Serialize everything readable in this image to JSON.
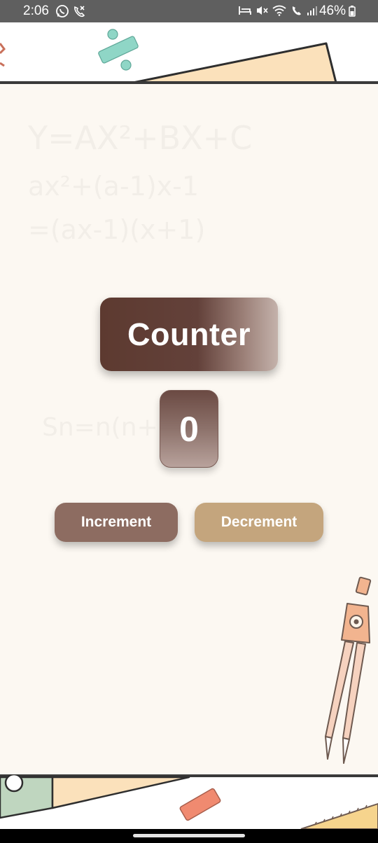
{
  "status_bar": {
    "time": "2:06",
    "battery": "46%",
    "left_icons": [
      "whatsapp-icon",
      "missed-call-icon"
    ],
    "right_icons": [
      "bed-icon",
      "mute-icon",
      "wifi-icon",
      "wifi-call-icon",
      "signal-icon",
      "battery-icon"
    ]
  },
  "counter": {
    "title": "Counter",
    "value": "0"
  },
  "buttons": {
    "increment_label": "Increment",
    "decrement_label": "Decrement"
  },
  "background_math": {
    "line1": "Y=AX²+BX+C",
    "line2": "ax²+(a-1)x-1",
    "line3": "=(ax-1)(x+1)",
    "line4": "Sn=n(n+2)"
  },
  "colors": {
    "title_gradient_start": "#5d3a30",
    "title_gradient_end": "#c4b2ab",
    "increment_button": "#8d6c61",
    "decrement_button": "#c4a57d",
    "background": "#fcf8f2",
    "status_bar": "#5f5f5f"
  }
}
